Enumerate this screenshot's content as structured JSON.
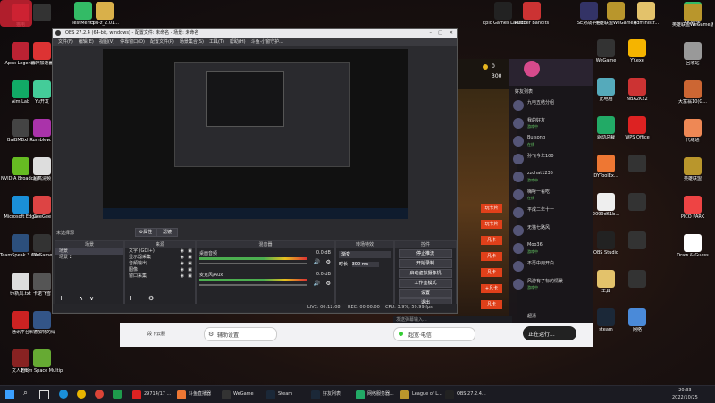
{
  "desktop": {
    "left_col1": [
      {
        "label": "猫电",
        "icon": "logo-icon",
        "color": "#cc2233"
      },
      {
        "label": "Apex Legends",
        "icon": "apex-icon",
        "color": "#b23"
      },
      {
        "label": "Aim Lab",
        "icon": "aimlab-icon",
        "color": "#1a6"
      },
      {
        "label": "BaiBMBxh...",
        "icon": "app-icon",
        "color": "#444"
      },
      {
        "label": "NVIDIA Broadcast",
        "icon": "nvidia-icon",
        "color": "#6b2"
      },
      {
        "label": "Microsoft Edge",
        "icon": "edge-icon",
        "color": "#1a8fd8"
      },
      {
        "label": "TeamSpeak 3 Client",
        "icon": "teamspeak-icon",
        "color": "#2c4f7c"
      },
      {
        "label": "tv新风.txt",
        "icon": "file-icon",
        "color": "#ddd"
      },
      {
        "label": "通讯平台",
        "icon": "app-icon",
        "color": "#c22"
      },
      {
        "label": "文人超时",
        "icon": "app-icon",
        "color": "#822"
      }
    ],
    "left_col2": [
      {
        "label": "",
        "icon": "blank-icon",
        "color": "#333"
      },
      {
        "label": "雷神加速器",
        "icon": "app-icon",
        "color": "#d33"
      },
      {
        "label": "Yu开发",
        "icon": "app-icon",
        "color": "#4c9"
      },
      {
        "label": "Rumblew...",
        "icon": "app-icon",
        "color": "#a3a"
      },
      {
        "label": "超高清频",
        "icon": "file-icon",
        "color": "#ddd"
      },
      {
        "label": "GeeGee",
        "icon": "app-icon",
        "color": "#d44"
      },
      {
        "label": "WeGame",
        "icon": "wegame-icon",
        "color": "#333"
      },
      {
        "label": "卡诺飞雪",
        "icon": "app-icon",
        "color": "#555"
      },
      {
        "label": "米德加特的绿",
        "icon": "app-icon",
        "color": "#358"
      },
      {
        "label": "From Space Multiple...",
        "icon": "app-icon",
        "color": "#6a3"
      }
    ],
    "top_row": [
      {
        "label": "TestMem5",
        "icon": "folder-icon",
        "color": "#3b6"
      },
      {
        "label": "cpu-z_2.01...",
        "icon": "folder-icon",
        "color": "#d9b04a"
      },
      {
        "label": "Epic Games Launcher",
        "icon": "epic-icon",
        "color": "#222"
      },
      {
        "label": "Rubber Bandits",
        "icon": "app-icon",
        "color": "#c33"
      },
      {
        "label": "SE对战平台",
        "icon": "app-icon",
        "color": "#336"
      },
      {
        "label": "英雄联盟WeGame版",
        "icon": "lol-icon",
        "color": "#b9962c"
      },
      {
        "label": "Administr...",
        "icon": "folder-icon",
        "color": "#e3c26b"
      },
      {
        "label": "QQ音乐",
        "icon": "qqmusic-icon",
        "color": "#33bb66"
      }
    ],
    "right_col1": [
      {
        "label": "WeGame",
        "icon": "wegame-icon",
        "color": "#333"
      },
      {
        "label": "此电脑",
        "icon": "pc-icon",
        "color": "#5ab"
      },
      {
        "label": "驱动总裁",
        "icon": "app-icon",
        "color": "#2a6"
      },
      {
        "label": "DYToolEx...",
        "icon": "app-icon",
        "color": "#e73"
      },
      {
        "label": "2099d61b...",
        "icon": "file-icon",
        "color": "#eee"
      },
      {
        "label": "OBS Studio",
        "icon": "obs-icon",
        "color": "#222"
      },
      {
        "label": "工具",
        "icon": "folder-icon",
        "color": "#e3c26b"
      },
      {
        "label": "steam",
        "icon": "steam-icon",
        "color": "#1b2838"
      }
    ],
    "right_col2": [
      {
        "label": "YY.exe",
        "icon": "app-icon",
        "color": "#f5b400"
      },
      {
        "label": "NBA2K22",
        "icon": "app-icon",
        "color": "#c33"
      },
      {
        "label": "WPS Office",
        "icon": "wps-icon",
        "color": "#d22"
      },
      {
        "label": "",
        "icon": "blank-icon",
        "color": "#333"
      },
      {
        "label": "",
        "icon": "blank-icon",
        "color": "#333"
      },
      {
        "label": "",
        "icon": "blank-icon",
        "color": "#333"
      },
      {
        "label": "",
        "icon": "blank-icon",
        "color": "#333"
      },
      {
        "label": "网络",
        "icon": "network-icon",
        "color": "#4a8ad9"
      }
    ],
    "right_col3": [
      {
        "label": "英雄联盟WeGame版",
        "icon": "lol-icon",
        "color": "#b9962c"
      },
      {
        "label": "回收站",
        "icon": "recycle-icon",
        "color": "#999"
      },
      {
        "label": "大富翁10(G...",
        "icon": "app-icon",
        "color": "#c63"
      },
      {
        "label": "代练通",
        "icon": "app-icon",
        "color": "#e85"
      },
      {
        "label": "英雄联盟",
        "icon": "lol-icon",
        "color": "#b9962c"
      },
      {
        "label": "PICO PARK",
        "icon": "app-icon",
        "color": "#e44"
      },
      {
        "label": "Draw & Guess",
        "icon": "app-icon",
        "color": "#fff"
      }
    ]
  },
  "obs": {
    "title": "OBS 27.2.4 (64-bit, windows) - 配置文件: 未命名 - 场景: 未命名",
    "menu": [
      "文件(F)",
      "编辑(E)",
      "视图(V)",
      "停靠窗口(D)",
      "配置文件(P)",
      "场景集合(S)",
      "工具(T)",
      "帮助(H)",
      "斗鱼·小窗守护..."
    ],
    "no_source": "未选择源",
    "properties_btn": "属性",
    "filters_btn": "滤镜",
    "panels": {
      "scenes": "场景",
      "sources": "来源",
      "mixer": "混音器",
      "transitions": "转场特效",
      "controls": "控件"
    },
    "scenes": [
      "场景",
      "场景 2"
    ],
    "sources": [
      "文字 (GDI+)",
      "显示器采集",
      "音频输出",
      "图像",
      "窗口采集"
    ],
    "mixer": [
      {
        "name": "桌面音频",
        "level": "0.0 dB"
      },
      {
        "name": "麦克风/Aux",
        "level": "0.0 dB"
      }
    ],
    "transition": {
      "type": "渐变",
      "duration_label": "时长",
      "duration": "300 ms"
    },
    "controls": [
      "停止推流",
      "开始录制",
      "启动虚拟摄像机",
      "工作室模式",
      "设置",
      "退出"
    ],
    "status": {
      "live": "LIVE: 00:12:08",
      "rec": "REC: 00:00:00",
      "cpu": "CPU: 3.9%, 59.99 fps"
    }
  },
  "chat": {
    "count1": "0",
    "count2": "300",
    "friend_list": "好友列表",
    "items": [
      {
        "name": "九电五结分组",
        "note": ""
      },
      {
        "name": "我的好友",
        "note": "游戏中"
      },
      {
        "name": "Bulsong",
        "note": "在线"
      },
      {
        "name": "孙飞今年100",
        "note": ""
      },
      {
        "name": "zzchat1235",
        "note": "游戏中"
      },
      {
        "name": "嗨呀一看吃",
        "note": "在线"
      },
      {
        "name": "平成二年十一",
        "note": ""
      },
      {
        "name": "无猫七路风",
        "note": ""
      },
      {
        "name": "Moo36",
        "note": "游戏中"
      },
      {
        "name": "不再中用开白",
        "note": ""
      },
      {
        "name": "风游有了标的情景",
        "note": "游戏中"
      }
    ],
    "game_labels": [
      "玩卡片",
      "玩卡片",
      "凡卡",
      "凡卡",
      "凡卡",
      "+凡卡",
      "凡卡",
      "凡卡"
    ],
    "input_placeholder": "发送弹幕输入..."
  },
  "bottom_bar": {
    "item1": "段下云服",
    "item2": "辅助设置",
    "item3": "超宽·电信",
    "item4": "正在运行...",
    "item5": "超清"
  },
  "taskbar": {
    "items": [
      {
        "label": "29714/17 ...",
        "color": "#d22"
      },
      {
        "label": "斗鱼直播器",
        "color": "#e73"
      },
      {
        "label": "WeGame",
        "color": "#333"
      },
      {
        "label": "Steam",
        "color": "#1b2838"
      },
      {
        "label": "好友列表",
        "color": "#1b2838"
      },
      {
        "label": "网络服务器...",
        "color": "#2a6"
      },
      {
        "label": "League of L...",
        "color": "#b9962c"
      },
      {
        "label": "OBS 27.2.4...",
        "color": "#222"
      }
    ],
    "time": "20:33",
    "date": "2022/10/25"
  },
  "colors": {
    "obs_bg": "#2b2b2f",
    "accent_red": "#cc2233",
    "chat_badge": "#e0401a"
  }
}
